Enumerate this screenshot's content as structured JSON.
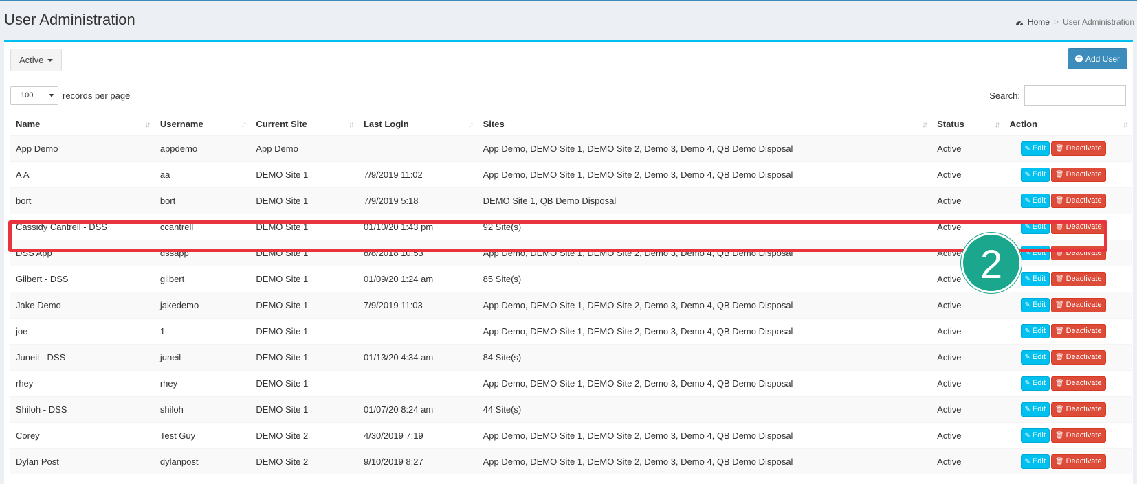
{
  "page": {
    "title": "User Administration",
    "breadcrumb": {
      "home": "Home",
      "current": "User Administration"
    }
  },
  "toolbar": {
    "status_filter": "Active",
    "add_user": "Add User"
  },
  "table_controls": {
    "length_value": "100",
    "length_label": "records per page",
    "search_label": "Search:"
  },
  "table": {
    "columns": [
      "Name",
      "Username",
      "Current Site",
      "Last Login",
      "Sites",
      "Status",
      "Action"
    ],
    "edit_label": "Edit",
    "deactivate_label": "Deactivate",
    "rows": [
      {
        "name": "App Demo",
        "username": "appdemo",
        "current_site": "App Demo",
        "last_login": "",
        "sites": "App Demo, DEMO Site 1, DEMO Site 2, Demo 3, Demo 4, QB Demo Disposal",
        "status": "Active"
      },
      {
        "name": "A A",
        "username": "aa",
        "current_site": "DEMO Site 1",
        "last_login": "7/9/2019 11:02",
        "sites": "App Demo, DEMO Site 1, DEMO Site 2, Demo 3, Demo 4, QB Demo Disposal",
        "status": "Active"
      },
      {
        "name": "bort",
        "username": "bort",
        "current_site": "DEMO Site 1",
        "last_login": "7/9/2019 5:18",
        "sites": "DEMO Site 1, QB Demo Disposal",
        "status": "Active"
      },
      {
        "name": "Cassidy Cantrell - DSS",
        "username": "ccantrell",
        "current_site": "DEMO Site 1",
        "last_login": "01/10/20 1:43 pm",
        "sites": "92 Site(s)",
        "status": "Active"
      },
      {
        "name": "DSS App",
        "username": "dssapp",
        "current_site": "DEMO Site 1",
        "last_login": "8/8/2018 10:53",
        "sites": "App Demo, DEMO Site 1, DEMO Site 2, Demo 3, Demo 4, QB Demo Disposal",
        "status": "Active"
      },
      {
        "name": "Gilbert - DSS",
        "username": "gilbert",
        "current_site": "DEMO Site 1",
        "last_login": "01/09/20 1:24 am",
        "sites": "85 Site(s)",
        "status": "Active"
      },
      {
        "name": "Jake Demo",
        "username": "jakedemo",
        "current_site": "DEMO Site 1",
        "last_login": "7/9/2019 11:03",
        "sites": "App Demo, DEMO Site 1, DEMO Site 2, Demo 3, Demo 4, QB Demo Disposal",
        "status": "Active"
      },
      {
        "name": "joe",
        "username": "1",
        "current_site": "DEMO Site 1",
        "last_login": "",
        "sites": "App Demo, DEMO Site 1, DEMO Site 2, Demo 3, Demo 4, QB Demo Disposal",
        "status": "Active"
      },
      {
        "name": "Juneil - DSS",
        "username": "juneil",
        "current_site": "DEMO Site 1",
        "last_login": "01/13/20 4:34 am",
        "sites": "84 Site(s)",
        "status": "Active"
      },
      {
        "name": "rhey",
        "username": "rhey",
        "current_site": "DEMO Site 1",
        "last_login": "",
        "sites": "App Demo, DEMO Site 1, DEMO Site 2, Demo 3, Demo 4, QB Demo Disposal",
        "status": "Active"
      },
      {
        "name": "Shiloh - DSS",
        "username": "shiloh",
        "current_site": "DEMO Site 1",
        "last_login": "01/07/20 8:24 am",
        "sites": "44 Site(s)",
        "status": "Active"
      },
      {
        "name": "Corey",
        "username": "Test Guy",
        "current_site": "DEMO Site 2",
        "last_login": "4/30/2019 7:19",
        "sites": "App Demo, DEMO Site 1, DEMO Site 2, Demo 3, Demo 4, QB Demo Disposal",
        "status": "Active"
      },
      {
        "name": "Dylan Post",
        "username": "dylanpost",
        "current_site": "DEMO Site 2",
        "last_login": "9/10/2019 8:27",
        "sites": "App Demo, DEMO Site 1, DEMO Site 2, Demo 3, Demo 4, QB Demo Disposal",
        "status": "Active"
      }
    ]
  },
  "annotation": {
    "step_number": "2",
    "color": "#1aa78d",
    "highlight_color": "#e9343d"
  },
  "colors": {
    "accent": "#3c8dbc",
    "info": "#00c0ef",
    "danger": "#dd4b39"
  },
  "icons": {
    "breadcrumb_home": "dashboard-icon",
    "add_user": "plus-circle-icon",
    "edit": "edit-icon",
    "deactivate": "trash-icon",
    "sort": "sort-icon"
  }
}
